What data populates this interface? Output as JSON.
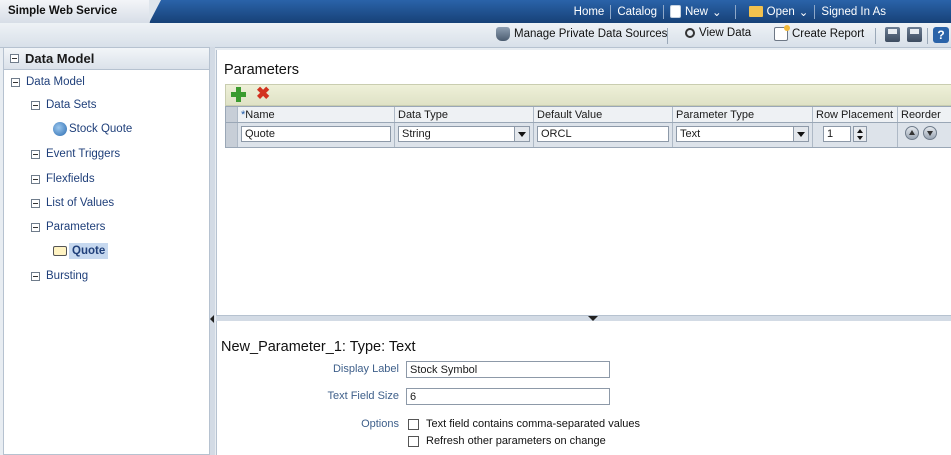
{
  "app": {
    "title": "Simple Web Service"
  },
  "topnav": {
    "home": "Home",
    "catalog": "Catalog",
    "new": "New",
    "open": "Open",
    "signed_in": "Signed In As"
  },
  "toolbar": {
    "manage": "Manage Private Data Sources",
    "view_data": "View Data",
    "create_report": "Create Report"
  },
  "left": {
    "header": "Data Model",
    "tree": {
      "root": "Data Model",
      "data_sets": "Data Sets",
      "stock_quote": "Stock Quote",
      "event_triggers": "Event Triggers",
      "flexfields": "Flexfields",
      "list_of_values": "List of Values",
      "parameters": "Parameters",
      "quote": "Quote",
      "bursting": "Bursting"
    }
  },
  "main": {
    "title": "Parameters",
    "grid": {
      "columns": {
        "required_mark": "*",
        "name": "Name",
        "data_type": "Data Type",
        "default_value": "Default Value",
        "parameter_type": "Parameter Type",
        "row_placement": "Row Placement",
        "reorder": "Reorder"
      },
      "row": {
        "name": "Quote",
        "data_type": "String",
        "default_value": "ORCL",
        "parameter_type": "Text",
        "row_placement": "1"
      }
    }
  },
  "details": {
    "title": "New_Parameter_1: Type: Text",
    "display_label_label": "Display Label",
    "display_label_value": "Stock Symbol",
    "text_field_size_label": "Text Field Size",
    "text_field_size_value": "6",
    "options_label": "Options",
    "option_comma": "Text field contains comma-separated values",
    "option_refresh": "Refresh other parameters on change"
  },
  "colors": {
    "topbar": "#1e4f8e",
    "selection": "#c6d8ef",
    "link": "#1f3f7a",
    "add": "#3a9b2f",
    "delete": "#d2321f"
  }
}
